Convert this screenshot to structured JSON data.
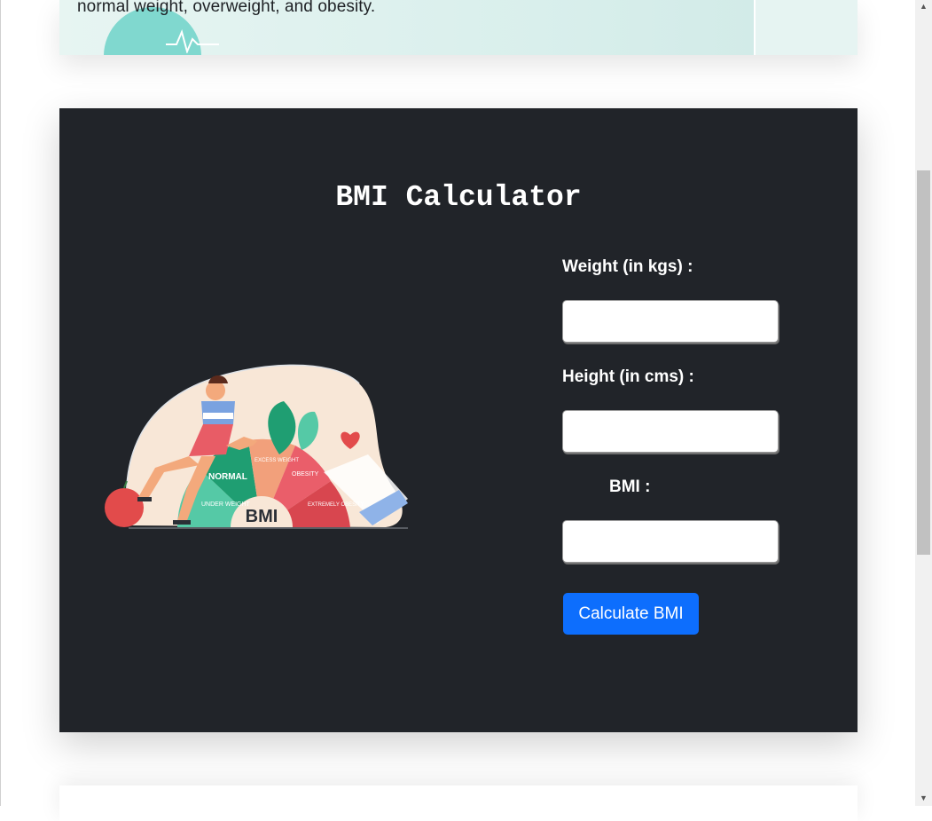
{
  "hero": {
    "text": "normal weight, overweight, and obesity."
  },
  "calculator": {
    "title": "BMI Calculator",
    "weight_label": "Weight (in kgs) :",
    "weight_value": "",
    "height_label": "Height (in cms) :",
    "height_value": "",
    "bmi_label": "BMI :",
    "bmi_value": "",
    "button_label": "Calculate BMI",
    "illustration": {
      "segments": [
        "UNDER WEIGHT",
        "NORMAL",
        "EXCESS WEIGHT",
        "OBESITY",
        "EXTREMELY OBESITY"
      ],
      "center_label": "BMI"
    }
  },
  "colors": {
    "card_bg": "#212429",
    "button": "#0d6efd",
    "accent_teal": "#74d5cb"
  }
}
